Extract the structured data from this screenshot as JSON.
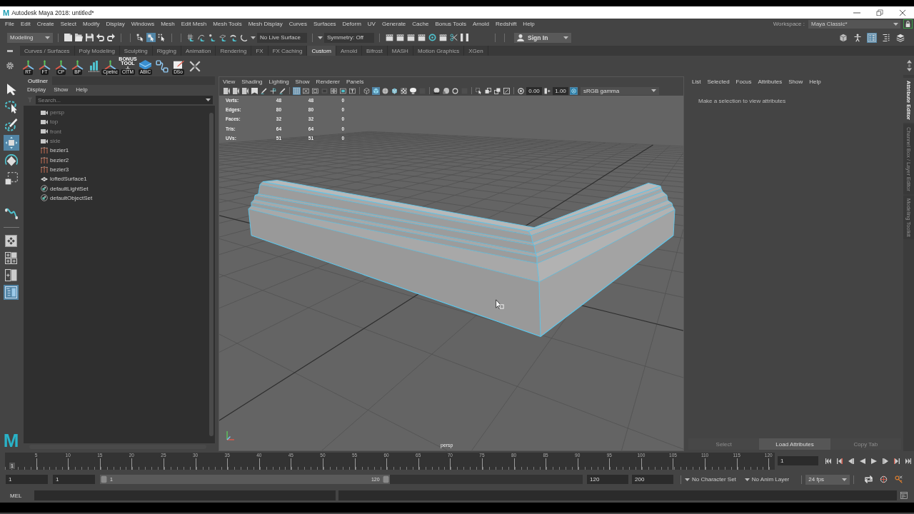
{
  "window": {
    "app_icon": "M",
    "title": "Autodesk Maya 2018: untitled*"
  },
  "menu_bar": [
    "File",
    "Edit",
    "Create",
    "Select",
    "Modify",
    "Display",
    "Windows",
    "Mesh",
    "Edit Mesh",
    "Mesh Tools",
    "Mesh Display",
    "Curves",
    "Surfaces",
    "Deform",
    "UV",
    "Generate",
    "Cache",
    "Bonus Tools",
    "Arnold",
    "Redshift",
    "Help"
  ],
  "workspace": {
    "label": "Workspace :",
    "value": "Maya Classic*",
    "locked": true
  },
  "status_line": {
    "menu_set": "Modeling",
    "selection_modes": [
      {
        "kind": "hierarchy",
        "selected": false
      },
      {
        "kind": "object",
        "selected": true
      },
      {
        "kind": "component",
        "selected": false
      }
    ],
    "live_surface": "No Live Surface",
    "symmetry": "Symmetry: Off",
    "sign_in": "Sign In",
    "panel_toggles": [
      {
        "kind": "toolkit",
        "selected": false
      },
      {
        "kind": "human_ik",
        "selected": false
      },
      {
        "kind": "attribute_editor",
        "selected": true
      },
      {
        "kind": "tool_settings",
        "selected": false
      },
      {
        "kind": "channel_box",
        "selected": false
      }
    ]
  },
  "shelf": {
    "tabs": [
      {
        "label": "Curves / Surfaces",
        "selected": false
      },
      {
        "label": "Poly Modeling",
        "selected": false
      },
      {
        "label": "Sculpting",
        "selected": false
      },
      {
        "label": "Rigging",
        "selected": false
      },
      {
        "label": "Animation",
        "selected": false
      },
      {
        "label": "Rendering",
        "selected": false
      },
      {
        "label": "FX",
        "selected": false
      },
      {
        "label": "FX Caching",
        "selected": false
      },
      {
        "label": "Custom",
        "selected": true
      },
      {
        "label": "Arnold",
        "selected": false
      },
      {
        "label": "Bifrost",
        "selected": false
      },
      {
        "label": "MASH",
        "selected": false
      },
      {
        "label": "Motion Graphics",
        "selected": false
      },
      {
        "label": "XGen",
        "selected": false
      }
    ],
    "buttons": [
      {
        "kind": "axes",
        "label": "RT"
      },
      {
        "kind": "axes",
        "label": "FT"
      },
      {
        "kind": "axes",
        "label": "CP"
      },
      {
        "kind": "axes",
        "label": "BP"
      },
      {
        "kind": "bars"
      },
      {
        "kind": "axes",
        "label": "Cpetnc"
      },
      {
        "kind": "bonus",
        "badge": "BONUS TOOL",
        "label": "CtTM"
      },
      {
        "kind": "slab",
        "label": "ABtC"
      },
      {
        "kind": "nodes"
      },
      {
        "kind": "note",
        "label": "DSo"
      },
      {
        "kind": "cross"
      }
    ]
  },
  "toolbox": {
    "tools": [
      {
        "kind": "select",
        "selected": false
      },
      {
        "kind": "lasso",
        "selected": false
      },
      {
        "kind": "paint",
        "selected": false
      },
      {
        "kind": "move",
        "selected": true
      },
      {
        "kind": "rotate",
        "selected": false
      },
      {
        "kind": "scale",
        "selected": false
      }
    ],
    "layouts": [
      {
        "kind": "single",
        "selected": false
      },
      {
        "kind": "four",
        "selected": false
      },
      {
        "kind": "two",
        "selected": false
      },
      {
        "kind": "outliner",
        "selected": true
      }
    ],
    "logo": "M"
  },
  "outliner": {
    "title": "Outliner",
    "menu": [
      "Display",
      "Show",
      "Help"
    ],
    "search": {
      "placeholder": "Search..."
    },
    "items": [
      {
        "kind": "camera",
        "name": "persp",
        "hidden": true
      },
      {
        "kind": "camera",
        "name": "top",
        "hidden": true
      },
      {
        "kind": "camera",
        "name": "front",
        "hidden": true
      },
      {
        "kind": "camera",
        "name": "side",
        "hidden": true
      },
      {
        "kind": "curve",
        "name": "bezier1",
        "hidden": false
      },
      {
        "kind": "curve",
        "name": "bezier2",
        "hidden": false
      },
      {
        "kind": "curve",
        "name": "bezier3",
        "hidden": false
      },
      {
        "kind": "surface",
        "name": "loftedSurface1",
        "hidden": false
      },
      {
        "kind": "set",
        "name": "defaultLightSet",
        "hidden": false
      },
      {
        "kind": "set",
        "name": "defaultObjectSet",
        "hidden": false
      }
    ]
  },
  "viewport": {
    "menu": [
      "View",
      "Shading",
      "Lighting",
      "Show",
      "Renderer",
      "Panels"
    ],
    "gate_buttons": [
      {
        "kind": "grid",
        "selected": true
      },
      {
        "kind": "film",
        "selected": false
      },
      {
        "kind": "resolution",
        "selected": false
      },
      {
        "kind": "mask",
        "selected": false
      },
      {
        "kind": "field",
        "selected": false
      },
      {
        "kind": "safe_action",
        "selected": false
      },
      {
        "kind": "safe_title",
        "selected": false
      }
    ],
    "shading_buttons": [
      {
        "kind": "wireframe",
        "selected": false
      },
      {
        "kind": "smooth",
        "selected": true
      },
      {
        "kind": "material",
        "selected": false
      },
      {
        "kind": "wire_on_shaded",
        "selected": false
      },
      {
        "kind": "textured",
        "selected": false
      },
      {
        "kind": "lights",
        "selected": false
      }
    ],
    "exposure": "0.00",
    "gamma": "1.00",
    "color_management": {
      "on": true
    },
    "view_transform": "sRGB gamma",
    "hud": [
      {
        "label": "Verts:",
        "values": [
          "48",
          "48",
          "0"
        ]
      },
      {
        "label": "Edges:",
        "values": [
          "80",
          "80",
          "0"
        ]
      },
      {
        "label": "Faces:",
        "values": [
          "32",
          "32",
          "0"
        ]
      },
      {
        "label": "Tris:",
        "values": [
          "64",
          "64",
          "0"
        ]
      },
      {
        "label": "UVs:",
        "values": [
          "51",
          "51",
          "0"
        ]
      }
    ],
    "camera": "persp"
  },
  "attribute_editor": {
    "menu": [
      "List",
      "Selected",
      "Focus",
      "Attributes",
      "Show",
      "Help"
    ],
    "message": "Make a selection to view attributes",
    "buttons": [
      {
        "label": "Select",
        "disabled": true
      },
      {
        "label": "Load Attributes",
        "disabled": false
      },
      {
        "label": "Copy Tab",
        "disabled": true
      }
    ]
  },
  "side_tabs": [
    {
      "label": "Attribute Editor",
      "selected": true
    },
    {
      "label": "Channel Box / Layer Editor",
      "selected": false
    },
    {
      "label": "Modeling Toolkit",
      "selected": false
    }
  ],
  "time_slider": {
    "current_frame": "1",
    "ticks": [
      "5",
      "10",
      "15",
      "20",
      "25",
      "30",
      "35",
      "40",
      "45",
      "50",
      "55",
      "60",
      "65",
      "70",
      "75",
      "80",
      "85",
      "90",
      "95",
      "100",
      "105",
      "110",
      "115",
      "120"
    ],
    "frame_field": "1"
  },
  "range_slider": {
    "start": "1",
    "playback_start": "1",
    "range_start": "1",
    "range_end": "120",
    "level": 0.6,
    "playback_end": "120",
    "end": "200",
    "character_set": "No Character Set",
    "anim_layer": "No Anim Layer",
    "fps": "24 fps"
  },
  "command_line": {
    "language": "MEL"
  }
}
